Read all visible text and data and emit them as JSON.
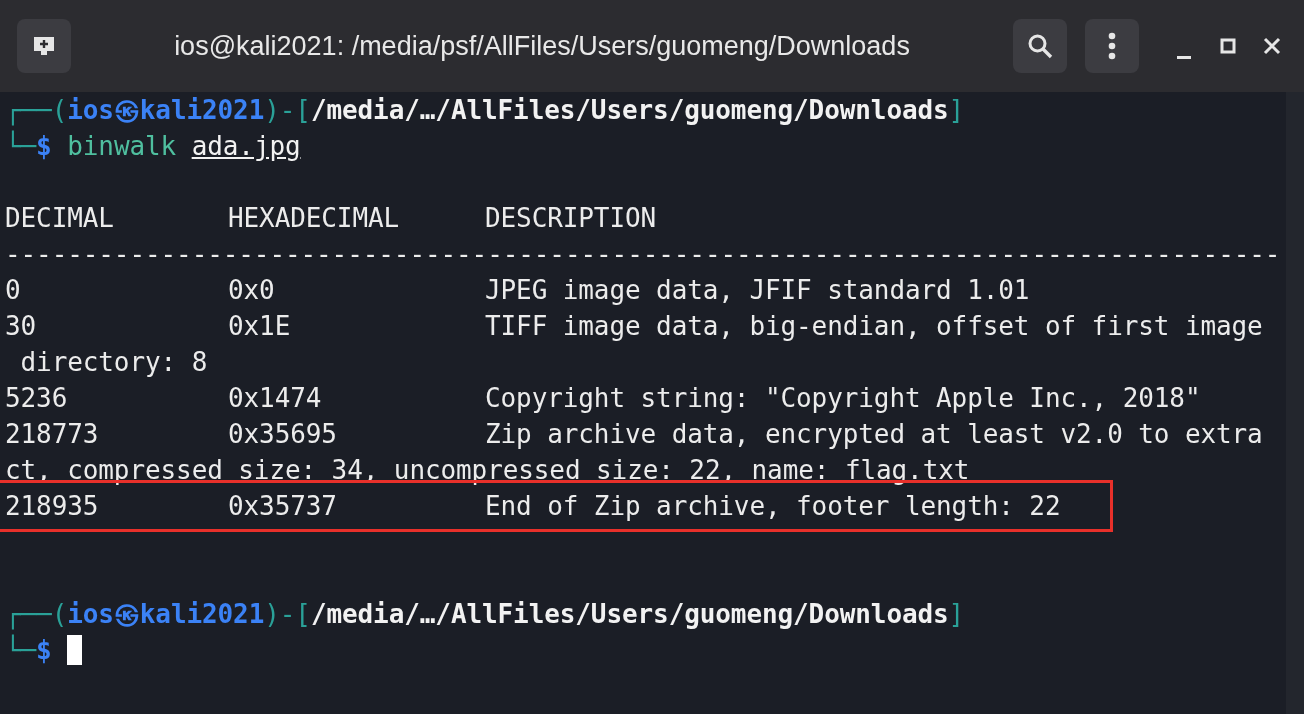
{
  "window": {
    "title": "ios@kali2021: /media/psf/AllFiles/Users/guomeng/Downloads"
  },
  "prompts": [
    {
      "open": "┌──(",
      "user": "ios",
      "at": "㉿",
      "host": "kali2021",
      "mid": ")-[",
      "path": "/media/…/AllFiles/Users/guomeng/Downloads",
      "close": "]",
      "corner": "└─",
      "symbol": "$",
      "command": "binwalk",
      "argument": "ada.jpg"
    },
    {
      "open": "┌──(",
      "user": "ios",
      "at": "㉿",
      "host": "kali2021",
      "mid": ")-[",
      "path": "/media/…/AllFiles/Users/guomeng/Downloads",
      "close": "]",
      "corner": "└─",
      "symbol": "$"
    }
  ],
  "table": {
    "columns": [
      "DECIMAL",
      "HEXADECIMAL",
      "DESCRIPTION"
    ],
    "rule": "----------------------------------------------------------------------------------",
    "rows": [
      {
        "decimal": "0",
        "hex": "0x0",
        "description": "JPEG image data, JFIF standard 1.01",
        "highlighted": false
      },
      {
        "decimal": "30",
        "hex": "0x1E",
        "description": "TIFF image data, big-endian, offset of first image",
        "continuation": " directory: 8",
        "highlighted": false
      },
      {
        "decimal": "5236",
        "hex": "0x1474",
        "description": "Copyright string: \"Copyright Apple Inc., 2018\"",
        "highlighted": false
      },
      {
        "decimal": "218773",
        "hex": "0x35695",
        "description": "Zip archive data, encrypted at least v2.0 to extra",
        "continuation": "ct, compressed size: 34, uncompressed size: 22, name: flag.txt",
        "highlighted": false
      },
      {
        "decimal": "218935",
        "hex": "0x35737",
        "description": "End of Zip archive, footer length: 22",
        "highlighted": true
      }
    ]
  }
}
